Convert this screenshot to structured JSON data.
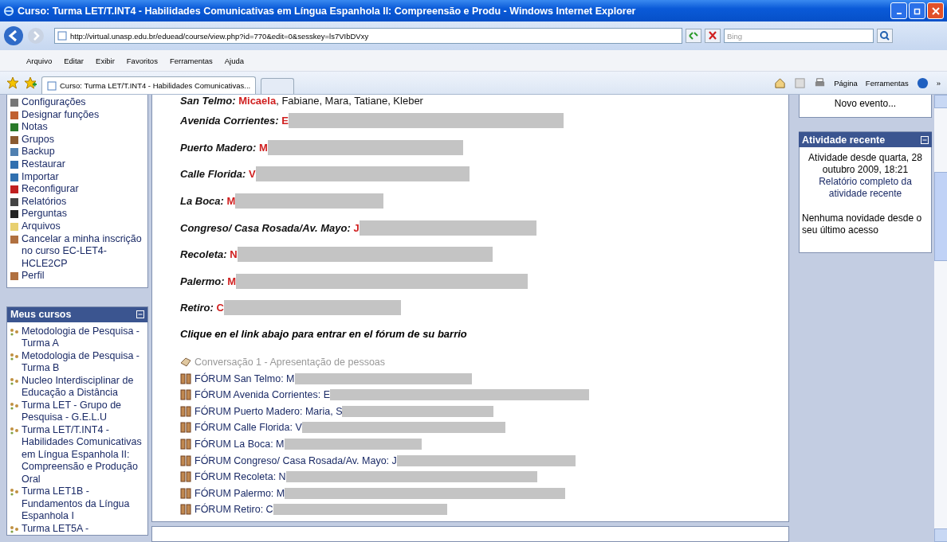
{
  "window": {
    "title": "Curso: Turma LET/T.INT4 - Habilidades Comunicativas em Língua Espanhola II: Compreensão e Produ - Windows Internet Explorer"
  },
  "address_bar": {
    "url": "http://virtual.unasp.edu.br/eduead/course/view.php?id=770&edit=0&sesskey=ls7VIbDVxy",
    "search_placeholder": "Bing"
  },
  "menu_bar": [
    "Arquivo",
    "Editar",
    "Exibir",
    "Favoritos",
    "Ferramentas",
    "Ajuda"
  ],
  "tabs": [
    {
      "label": "Curso: Turma LET/T.INT4 - Habilidades Comunicativas...",
      "selected": true
    }
  ],
  "command_bar": {
    "page": "Página",
    "tools": "Ferramentas",
    "more": "»"
  },
  "admin_block": {
    "items": [
      {
        "kind": "settings",
        "label": "Configurações"
      },
      {
        "kind": "roles",
        "label": "Designar funções"
      },
      {
        "kind": "grades",
        "label": "Notas"
      },
      {
        "kind": "groups",
        "label": "Grupos"
      },
      {
        "kind": "backup",
        "label": "Backup"
      },
      {
        "kind": "restore",
        "label": "Restaurar"
      },
      {
        "kind": "restore",
        "label": "Importar"
      },
      {
        "kind": "reset",
        "label": "Reconfigurar"
      },
      {
        "kind": "reports",
        "label": "Relatórios"
      },
      {
        "kind": "questions",
        "label": "Perguntas"
      },
      {
        "kind": "files",
        "label": "Arquivos"
      },
      {
        "kind": "user",
        "label": "Cancelar a minha inscrição no curso EC-LET4-HCLE2CP"
      },
      {
        "kind": "user",
        "label": "Perfil"
      }
    ]
  },
  "my_courses": {
    "title": "Meus cursos",
    "courses": [
      "Metodologia de Pesquisa - Turma A",
      "Metodologia de Pesquisa - Turma B",
      "Nucleo Interdisciplinar de Educação a Distância",
      "Turma LET - Grupo de Pesquisa - G.E.L.U",
      "Turma LET/T.INT4 - Habilidades Comunicativas em Língua Espanhola II: Compreensão e Produção Oral",
      "Turma LET1B - Fundamentos da Língua Espanhola I",
      "Turma LET5A -"
    ]
  },
  "main": {
    "groups": [
      {
        "label": "San Telmo:",
        "first_name": "Micaela",
        "rest": ", Fabiane, Mara, Tatiane, Kleber",
        "redacted": false
      },
      {
        "label": "Avenida Corrientes:",
        "first_name": "E",
        "redacted": true
      },
      {
        "label": "Puerto Madero:",
        "first_name": "M",
        "redacted": true
      },
      {
        "label": "Calle Florida:",
        "first_name": "V",
        "redacted": true
      },
      {
        "label": "La Boca:",
        "first_name": "M",
        "redacted": true
      },
      {
        "label": "Congreso/ Casa Rosada/Av. Mayo:",
        "first_name": "J",
        "redacted": true
      },
      {
        "label": "Recoleta:",
        "first_name": "N",
        "redacted": true
      },
      {
        "label": "Palermo:",
        "first_name": "M",
        "redacted": true
      },
      {
        "label": "Retiro:",
        "first_name": "C",
        "redacted": true
      }
    ],
    "instruction": "Clique en el link abajo para entrar en el fórum de su barrio",
    "activities": [
      {
        "kind": "chat",
        "label": "Conversação 1 - Apresentação de pessoas",
        "dimmed": true,
        "redacted": false
      },
      {
        "kind": "forum",
        "label": "FÓRUM San Telmo: M",
        "dimmed": false,
        "redacted": true
      },
      {
        "kind": "forum",
        "label": "FÓRUM Avenida Corrientes: E",
        "dimmed": false,
        "redacted": true
      },
      {
        "kind": "forum",
        "label": "FÓRUM Puerto Madero: Maria, S",
        "dimmed": false,
        "redacted": true
      },
      {
        "kind": "forum",
        "label": "FÓRUM Calle Florida: V",
        "dimmed": false,
        "redacted": true
      },
      {
        "kind": "forum",
        "label": "FÓRUM La Boca: M",
        "dimmed": false,
        "redacted": true
      },
      {
        "kind": "forum",
        "label": "FÓRUM Congreso/ Casa Rosada/Av. Mayo: J",
        "dimmed": false,
        "redacted": true
      },
      {
        "kind": "forum",
        "label": "FÓRUM Recoleta: N",
        "dimmed": false,
        "redacted": true
      },
      {
        "kind": "forum",
        "label": "FÓRUM Palermo: M",
        "dimmed": false,
        "redacted": true
      },
      {
        "kind": "forum",
        "label": "FÓRUM Retiro: C",
        "dimmed": false,
        "redacted": true
      }
    ]
  },
  "calendar_block": {
    "new_event": "Novo evento..."
  },
  "recent_activity": {
    "title": "Atividade recente",
    "since": "Atividade desde quarta, 28 outubro 2009, 18:21",
    "report_link": "Relatório completo da atividade recente",
    "message": "Nenhuma novidade desde o seu último acesso"
  }
}
